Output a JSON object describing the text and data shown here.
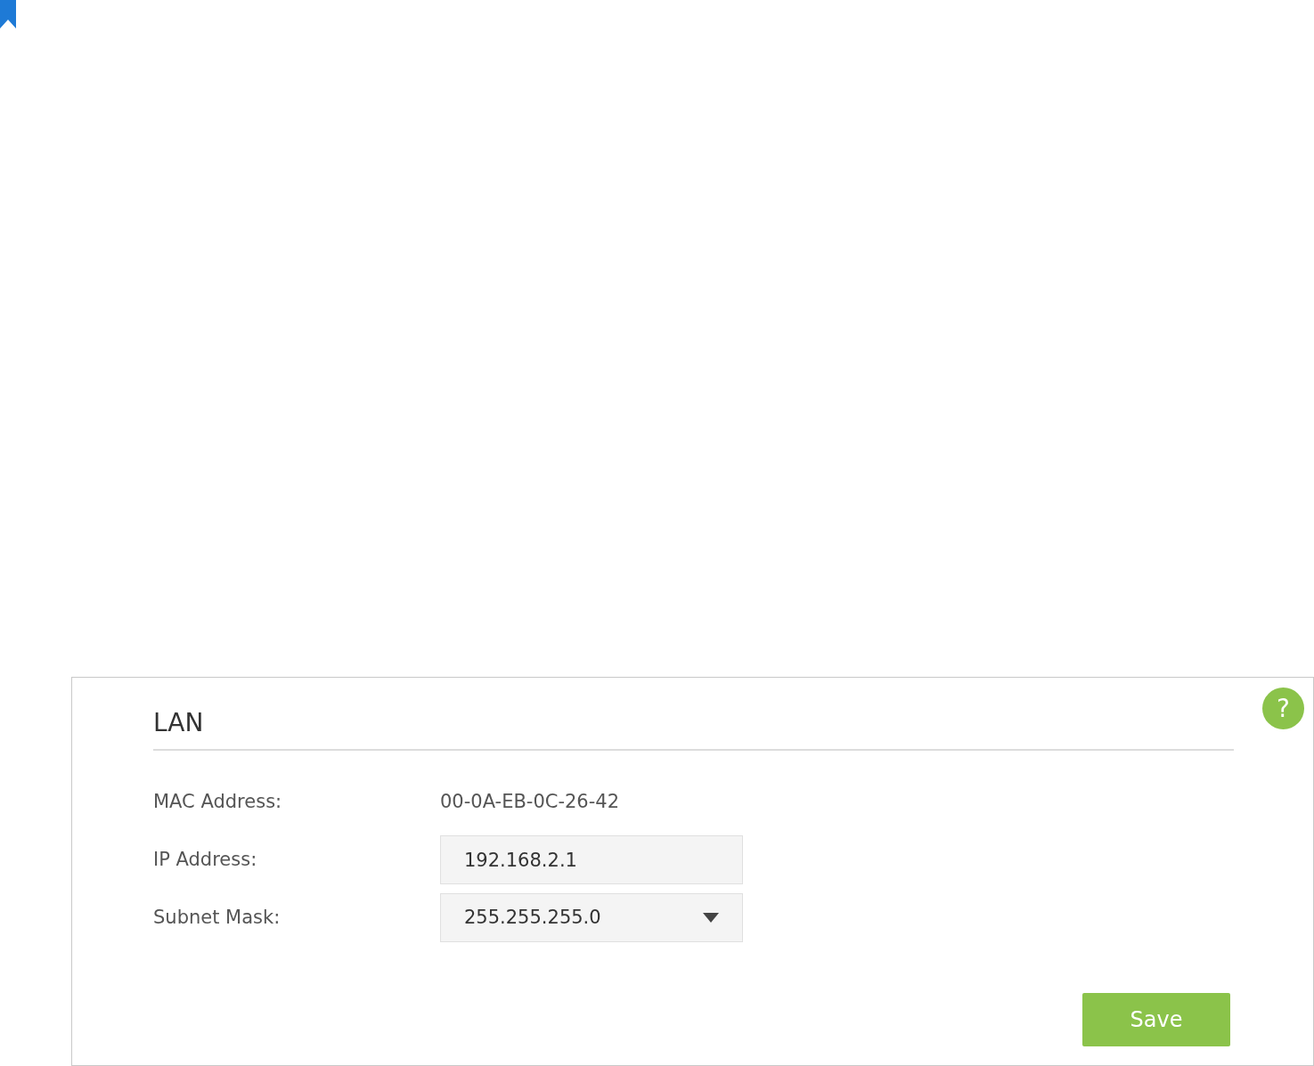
{
  "panel": {
    "title": "LAN",
    "fields": [
      {
        "kind": "static",
        "label": "MAC Address:",
        "value": "00-0A-EB-0C-26-42"
      },
      {
        "kind": "input",
        "label": "IP Address:",
        "value": "192.168.2.1"
      },
      {
        "kind": "select",
        "label": "Subnet Mask:",
        "value": "255.255.255.0"
      }
    ],
    "help": "?",
    "save_button": "Save"
  }
}
